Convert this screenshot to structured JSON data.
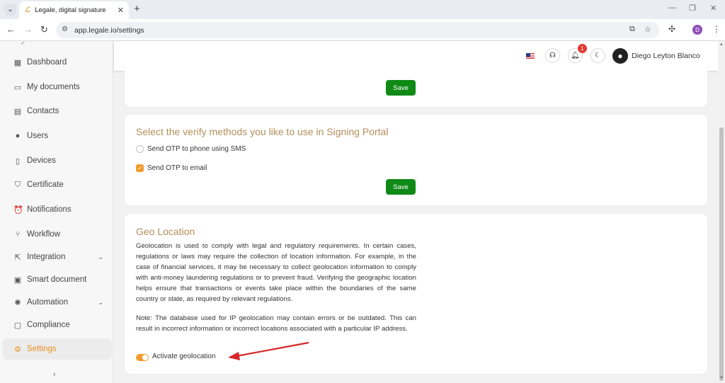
{
  "browser": {
    "tab_title": "Legale, digital signature",
    "url": "app.legale.io/settings",
    "profile_initial": "D",
    "icons": [
      "tab-search-icon",
      "close-icon",
      "new-tab-icon",
      "back-icon",
      "forward-icon",
      "reload-icon",
      "site-info-icon",
      "install-icon",
      "star-icon",
      "extensions-icon",
      "menu-icon",
      "minimize-icon",
      "restore-icon",
      "window-close-icon"
    ]
  },
  "sidebar": {
    "items": [
      {
        "label": "Dashboard",
        "icon": "dashboard-icon"
      },
      {
        "label": "My documents",
        "icon": "folder-icon"
      },
      {
        "label": "Contacts",
        "icon": "contacts-icon"
      },
      {
        "label": "Users",
        "icon": "user-icon"
      },
      {
        "label": "Devices",
        "icon": "device-icon"
      },
      {
        "label": "Certificate",
        "icon": "shield-icon"
      },
      {
        "label": "Notifications",
        "icon": "alarm-icon"
      },
      {
        "label": "Workflow",
        "icon": "workflow-icon"
      },
      {
        "label": "Integration",
        "icon": "integration-icon",
        "expandable": true
      },
      {
        "label": "Smart document",
        "icon": "smart-document-icon"
      },
      {
        "label": "Automation",
        "icon": "automation-icon",
        "expandable": true
      },
      {
        "label": "Compliance",
        "icon": "compliance-icon"
      },
      {
        "label": "Settings",
        "icon": "gear-icon",
        "active": true
      }
    ],
    "active_color": "#e8901f"
  },
  "header": {
    "notification_count": "1",
    "user_name": "Diego Leyton Blanco",
    "icons": [
      "us-flag-icon",
      "support-icon",
      "bell-icon",
      "theme-toggle-icon",
      "avatar-icon"
    ]
  },
  "cards": {
    "top": {
      "save_label": "Save"
    },
    "verify": {
      "title": "Select the verify methods you like to use in Signing Portal",
      "option_sms": "Send OTP to phone using SMS",
      "option_email": "Send OTP to email",
      "sms_checked": false,
      "email_checked": true,
      "save_label": "Save"
    },
    "geo": {
      "title": "Geo Location",
      "paragraph1": "Geolocation is used to comply with legal and regulatory requirements. In certain cases, regulations or laws may require the collection of location information. For example, in the case of financial services, it may be necessary to collect geolocation information to comply with anti-money laundering regulations or to prevent fraud. Verifying the geographic location helps ensure that transactions or events take place within the boundaries of the same country or state, as required by relevant regulations.",
      "paragraph2": "Note: The database used for IP geolocation may contain errors or be outdated. This can result in incorrect information or incorrect locations associated with a particular IP address.",
      "toggle_label": "Activate geolocation",
      "toggle_on": true
    }
  },
  "colors": {
    "save_button": "#0f8a17",
    "title": "#b38f5a",
    "accent": "#f29a2e",
    "annotation_arrow": "#d62828"
  }
}
